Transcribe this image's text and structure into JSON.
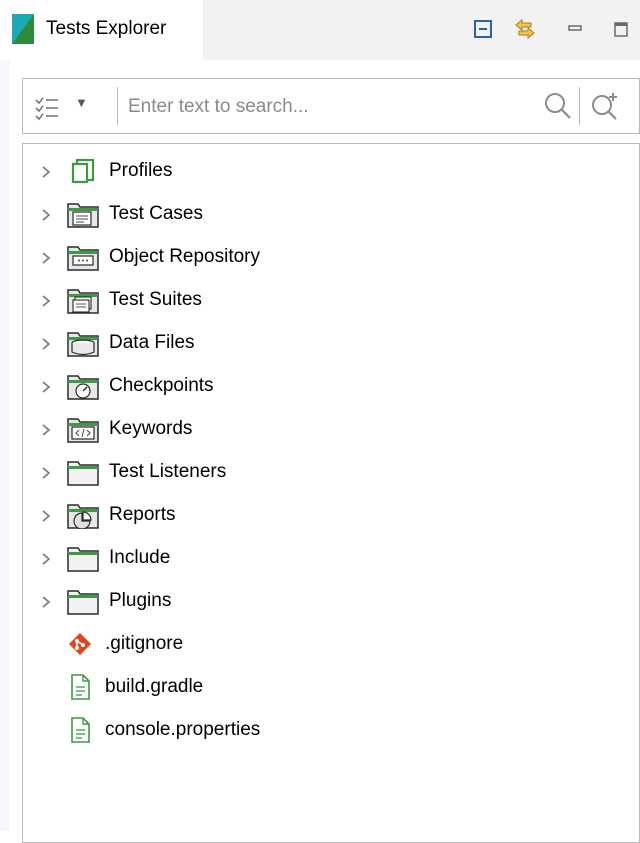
{
  "window": {
    "tab_title": "Tests Explorer",
    "toolbar_icons": [
      "collapse-all-icon",
      "link-with-editor-icon",
      "minimize-icon",
      "maximize-icon"
    ]
  },
  "search": {
    "placeholder": "Enter text to search...",
    "value": ""
  },
  "tree": {
    "folders": [
      {
        "label": "Profiles",
        "icon": "profiles-icon"
      },
      {
        "label": "Test Cases",
        "icon": "test-cases-icon"
      },
      {
        "label": "Object Repository",
        "icon": "object-repository-icon"
      },
      {
        "label": "Test Suites",
        "icon": "test-suites-icon"
      },
      {
        "label": "Data Files",
        "icon": "data-files-icon"
      },
      {
        "label": "Checkpoints",
        "icon": "checkpoints-icon"
      },
      {
        "label": "Keywords",
        "icon": "keywords-icon"
      },
      {
        "label": "Test Listeners",
        "icon": "folder-icon"
      },
      {
        "label": "Reports",
        "icon": "reports-icon"
      },
      {
        "label": "Include",
        "icon": "folder-icon"
      },
      {
        "label": "Plugins",
        "icon": "folder-icon"
      }
    ],
    "files": [
      {
        "label": ".gitignore",
        "icon": "git-icon"
      },
      {
        "label": "build.gradle",
        "icon": "file-icon"
      },
      {
        "label": "console.properties",
        "icon": "file-icon"
      }
    ]
  },
  "colors": {
    "folder_green": "#3e9a42",
    "folder_fill": "#f2f2f2",
    "git_red": "#e0451f",
    "logo_teal": "#1aa9b5",
    "logo_green": "#2e8b3a"
  }
}
